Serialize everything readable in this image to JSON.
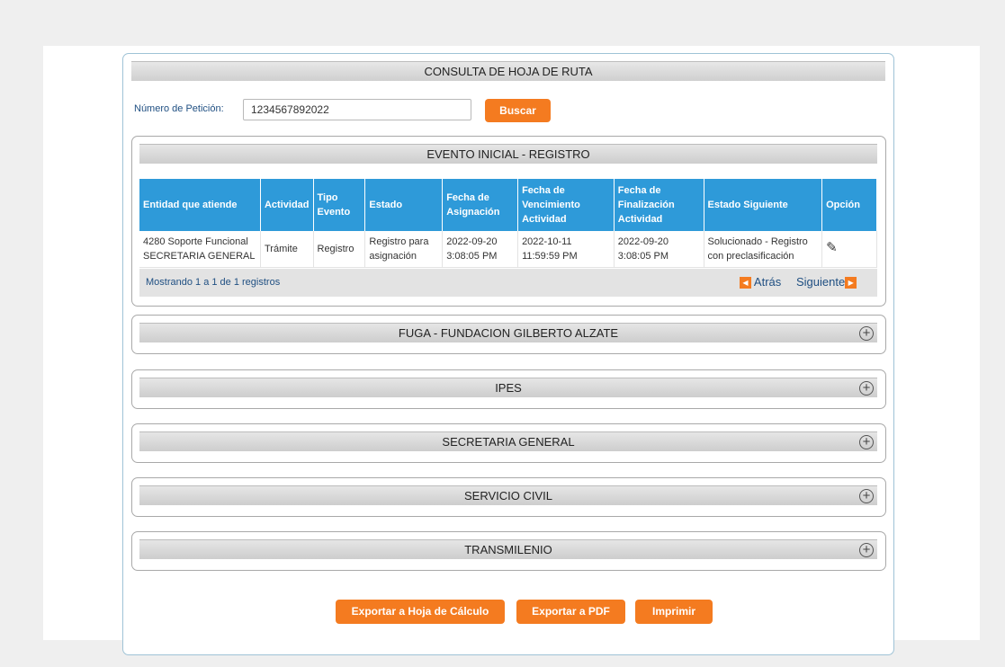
{
  "title": "CONSULTA DE HOJA DE RUTA",
  "search": {
    "label": "Número de Petición:",
    "value": "1234567892022",
    "button": "Buscar"
  },
  "initial_section": {
    "title": "EVENTO INICIAL - REGISTRO",
    "columns": [
      "Entidad que atiende",
      "Actividad",
      "Tipo Evento",
      "Estado",
      "Fecha de Asignación",
      "Fecha de Vencimiento Actividad",
      "Fecha de Finalización Actividad",
      "Estado Siguiente",
      "Opción"
    ],
    "rows": [
      [
        "4280 Soporte Funcional SECRETARIA GENERAL",
        "Trámite",
        "Registro",
        "Registro para asignación",
        "2022-09-20 3:08:05 PM",
        "2022-10-11 11:59:59 PM",
        "2022-09-20 3:08:05 PM",
        "Solucionado - Registro con preclasificación",
        "pencil-icon"
      ]
    ],
    "pager": {
      "info": "Mostrando 1 a 1 de 1 registros",
      "prev": "Atrás",
      "next": "Siguiente"
    }
  },
  "sections": [
    {
      "title": "FUGA - FUNDACION GILBERTO ALZATE",
      "icon": "plus-circle-icon"
    },
    {
      "title": "IPES",
      "icon": "plus-circle-icon"
    },
    {
      "title": "SECRETARIA GENERAL",
      "icon": "plus-circle-icon"
    },
    {
      "title": "SERVICIO CIVIL",
      "icon": "plus-circle-icon"
    },
    {
      "title": "TRANSMILENIO",
      "icon": "plus-circle-icon"
    }
  ],
  "actions": {
    "export_xls": "Exportar a Hoja de Cálculo",
    "export_pdf": "Exportar a PDF",
    "print": "Imprimir"
  },
  "colors": {
    "accent": "#f47b20",
    "table_header": "#2e9ad9",
    "link": "#1f4f82",
    "page_bg": "#efefef"
  }
}
